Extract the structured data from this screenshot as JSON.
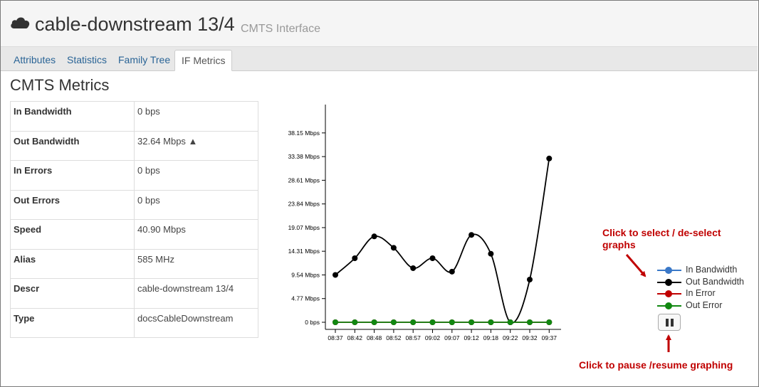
{
  "header": {
    "icon": "cloud-icon",
    "title": "cable-downstream 13/4",
    "subtitle": "CMTS Interface"
  },
  "tabs": [
    {
      "label": "Attributes",
      "active": false
    },
    {
      "label": "Statistics",
      "active": false
    },
    {
      "label": "Family Tree",
      "active": false
    },
    {
      "label": "IF Metrics",
      "active": true
    }
  ],
  "section_title": "CMTS Metrics",
  "metrics": [
    {
      "label": "In Bandwidth",
      "value": "0 bps"
    },
    {
      "label": "Out Bandwidth",
      "value": "32.64 Mbps ▲"
    },
    {
      "label": "In Errors",
      "value": "0 bps"
    },
    {
      "label": "Out Errors",
      "value": "0 bps"
    },
    {
      "label": "Speed",
      "value": "40.90 Mbps"
    },
    {
      "label": "Alias",
      "value": "585 MHz"
    },
    {
      "label": "Descr",
      "value": "cable-downstream 13/4"
    },
    {
      "label": "Type",
      "value": "docsCableDownstream"
    }
  ],
  "chart_data": {
    "type": "line",
    "x_ticks": [
      "08:37",
      "08:42",
      "08:48",
      "08:52",
      "08:57",
      "09:02",
      "09:07",
      "09:12",
      "09:18",
      "09:22",
      "09:32",
      "09:37"
    ],
    "y_ticks": [
      "0 bps",
      "4.77 Mbps",
      "9.54 Mbps",
      "14.31 Mbps",
      "19.07 Mbps",
      "23.84 Mbps",
      "28.61 Mbps",
      "33.38 Mbps",
      "38.15 Mbps"
    ],
    "y_tick_values": [
      0,
      4.77,
      9.54,
      14.31,
      19.07,
      23.84,
      28.61,
      33.38,
      38.15
    ],
    "ylim": [
      0,
      43
    ],
    "series": [
      {
        "name": "In Bandwidth",
        "color": "#3a78c8",
        "values": [
          0,
          0,
          0,
          0,
          0,
          0,
          0,
          0,
          0,
          0,
          0,
          0
        ]
      },
      {
        "name": "Out Bandwidth",
        "color": "#000000",
        "values": [
          9.54,
          12.9,
          17.3,
          15.0,
          10.9,
          12.9,
          10.2,
          17.6,
          13.8,
          0,
          8.6,
          33.0
        ]
      },
      {
        "name": "In Error",
        "color": "#c00000",
        "values": [
          0,
          0,
          0,
          0,
          0,
          0,
          0,
          0,
          0,
          0,
          0,
          0
        ]
      },
      {
        "name": "Out Error",
        "color": "#118811",
        "values": [
          0,
          0,
          0,
          0,
          0,
          0,
          0,
          0,
          0,
          0,
          0,
          0
        ]
      }
    ]
  },
  "legend": [
    {
      "label": "In Bandwidth",
      "color": "#3a78c8"
    },
    {
      "label": "Out Bandwidth",
      "color": "#000000"
    },
    {
      "label": "In Error",
      "color": "#c00000"
    },
    {
      "label": "Out Error",
      "color": "#118811"
    }
  ],
  "pause_button": {
    "icon": "pause-icon"
  },
  "annotations": {
    "select_text_line1": "Click to select / de-select",
    "select_text_line2": "graphs",
    "pause_text": "Click to pause /resume graphing",
    "color": "#c00000"
  }
}
